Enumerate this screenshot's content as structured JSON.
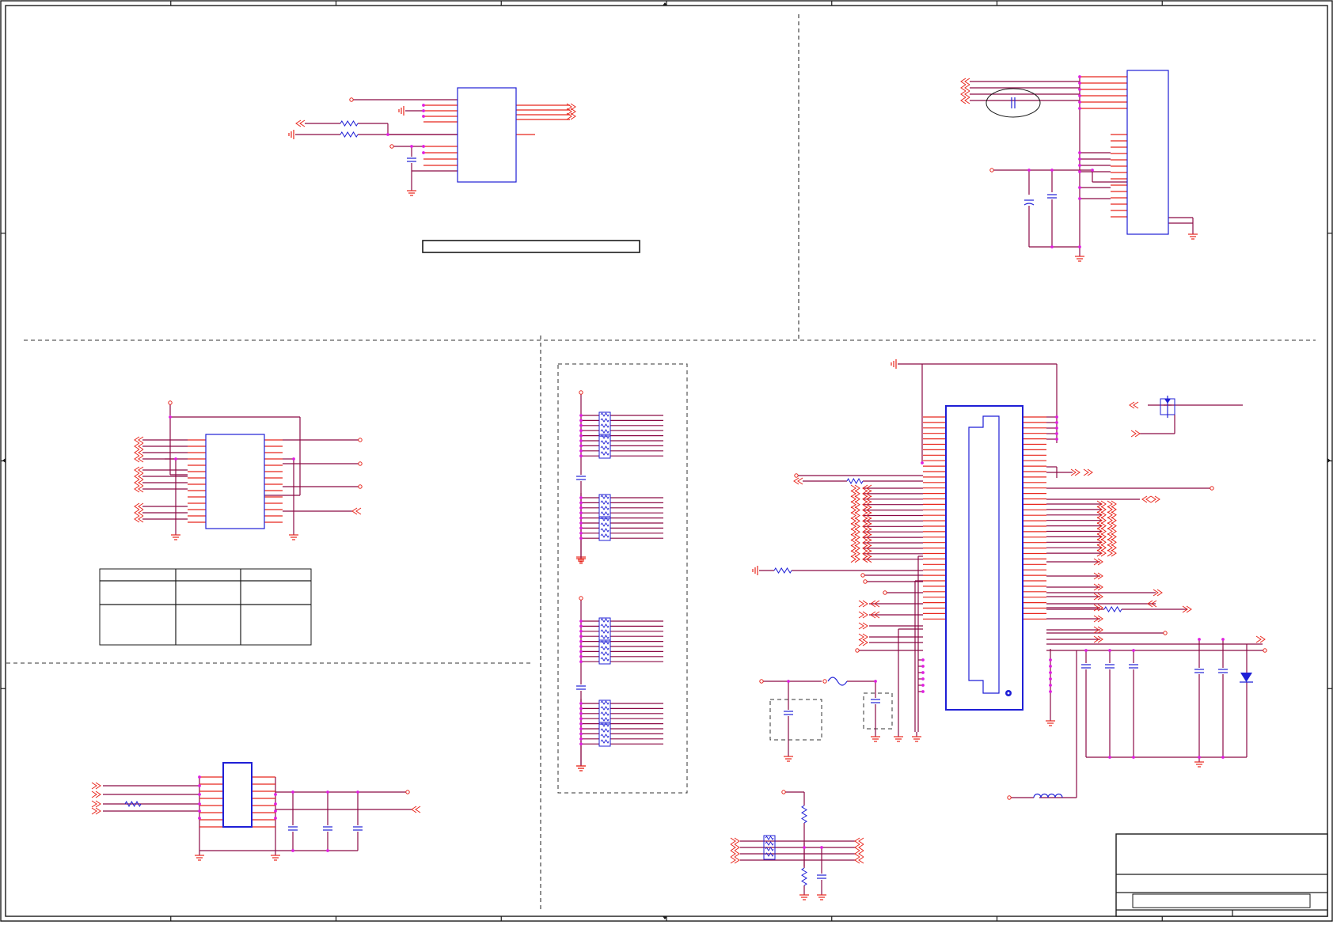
{
  "colors": {
    "wire": "#8b0a45",
    "pin": "#e8261c",
    "part": "#1f1fd6",
    "junction": "#e020e0",
    "border": "#1a1a1a",
    "divider": "#333333",
    "background": "#ffffff"
  },
  "sheet": {
    "width": 1684,
    "height": 1165,
    "zones_across": 8,
    "zones_down": 4
  },
  "blocks": [
    {
      "id": "top-left",
      "icon": "ic-chip-icon"
    },
    {
      "id": "top-right",
      "icon": "connector-icon"
    },
    {
      "id": "middle-left",
      "icon": "ic-chip-icon"
    },
    {
      "id": "bottom-left",
      "icon": "regulator-icon"
    },
    {
      "id": "resistor-networks",
      "icon": "resistor-network-icon"
    },
    {
      "id": "main-connector",
      "icon": "connector-icon"
    }
  ],
  "title_block": {
    "rows": 3,
    "sheet_text": ""
  }
}
